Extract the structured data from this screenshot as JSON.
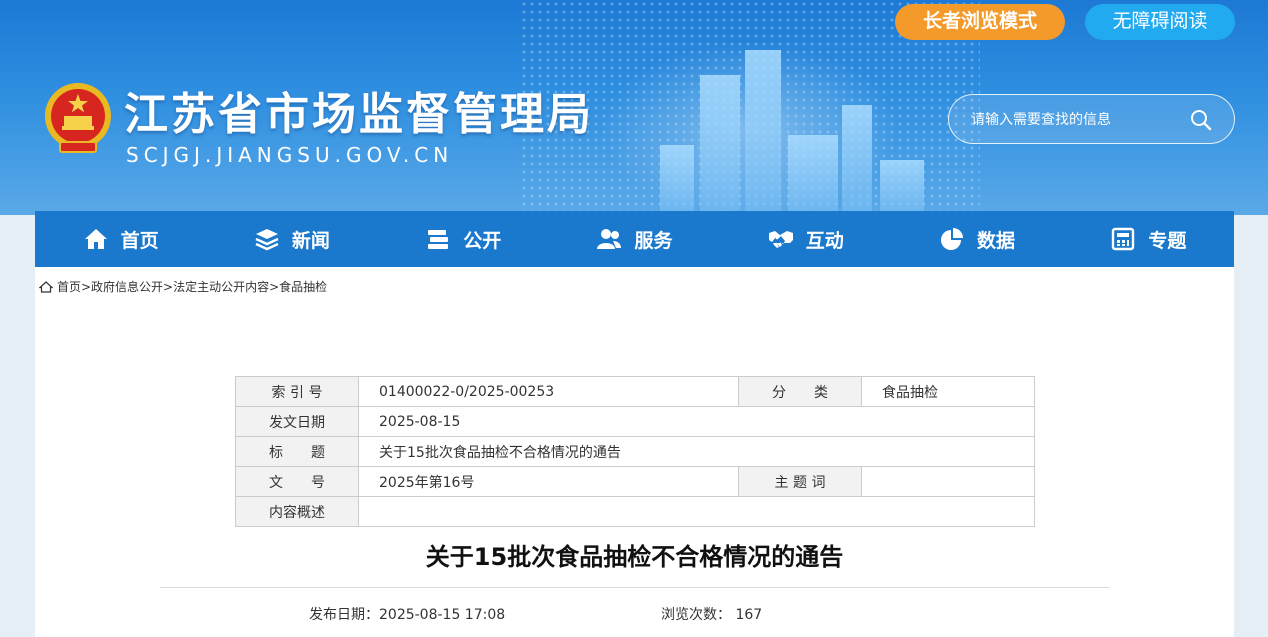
{
  "header": {
    "site_title": "江苏省市场监督管理局",
    "site_domain": "SCJGJ.JIANGSU.GOV.CN",
    "elder_mode": "长者浏览模式",
    "barrier_free": "无障碍阅读",
    "search_placeholder": "请输入需要查找的信息"
  },
  "nav": [
    {
      "label": "首页",
      "icon": "home-icon"
    },
    {
      "label": "新闻",
      "icon": "layers-icon"
    },
    {
      "label": "公开",
      "icon": "books-icon"
    },
    {
      "label": "服务",
      "icon": "users-icon"
    },
    {
      "label": "互动",
      "icon": "handshake-icon"
    },
    {
      "label": "数据",
      "icon": "pie-chart-icon"
    },
    {
      "label": "专题",
      "icon": "calculator-icon"
    }
  ],
  "breadcrumb": {
    "items": [
      "首页",
      "政府信息公开",
      "法定主动公开内容",
      "食品抽检"
    ],
    "text": "首页>政府信息公开>法定主动公开内容>食品抽检"
  },
  "meta": {
    "index_label": "索 引 号",
    "index_value": "01400022-0/2025-00253",
    "category_label": "分　　类",
    "category_value": "食品抽检",
    "date_label": "发文日期",
    "date_value": "2025-08-15",
    "title_label": "标　　题",
    "title_value": "关于15批次食品抽检不合格情况的通告",
    "docno_label": "文　　号",
    "docno_value": "2025年第16号",
    "subject_label": "主 题 词",
    "subject_value": "",
    "summary_label": "内容概述",
    "summary_value": ""
  },
  "article": {
    "title": "关于15批次食品抽检不合格情况的通告",
    "publish_label": "发布日期：",
    "publish_value": "2025-08-15 17:08",
    "views_label": "浏览次数：",
    "views_value": "167"
  },
  "colors": {
    "nav_bg": "#1a78cd",
    "elder_btn": "#f39a2b",
    "barrier_btn": "#22aaf0"
  }
}
